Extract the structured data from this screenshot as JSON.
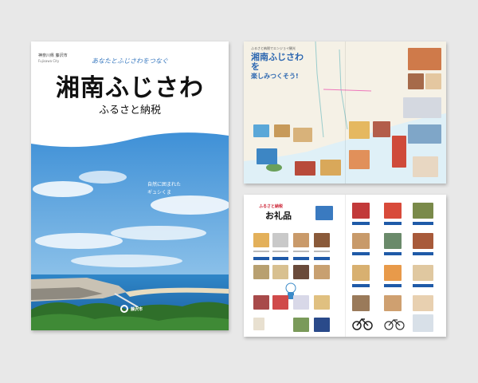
{
  "cover": {
    "city_tag": "神奈川県 藤沢市",
    "city_tag_en": "Fujisawa City",
    "tagline": "あなたとふじさわをつなぐ",
    "title": "湘南ふじさわ",
    "subtitle": "ふるさと納税",
    "photo_text_line1": "自然に囲まれた",
    "photo_text_line2": "ギュシくま",
    "logo_text": "藤沢市"
  },
  "map_page": {
    "tag": "ふるさと納税でエンジョイ観光",
    "title": "湘南ふじさわを",
    "subtitle": "楽しみつくそう!"
  },
  "gift_page": {
    "section_title": "お礼品",
    "section_deco": "ふるさと納税"
  },
  "colors": {
    "title_blue": "#2b66b0",
    "sea_blue": "#1f6fb8",
    "sky_blue": "#4a9ad8",
    "green": "#3f7f3a",
    "accent_red": "#cc2233"
  }
}
